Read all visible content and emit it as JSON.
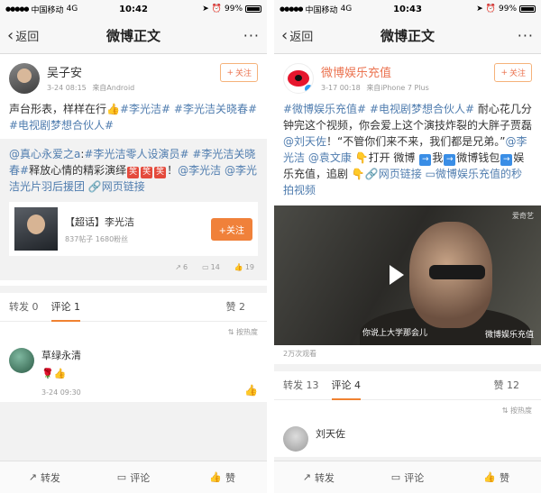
{
  "left": {
    "status": {
      "carrier": "中国移动",
      "network": "4G",
      "time": "10:42",
      "battery": "99%"
    },
    "nav": {
      "back": "返回",
      "title": "微博正文",
      "more": "···"
    },
    "post": {
      "user": "吴子安",
      "time": "3-24 08:15",
      "source": "来自Android",
      "follow": "关注",
      "text_plain": "声台形表，样样在行",
      "text_tags": "#李光洁# #李光洁关晓春# #电视剧梦想合伙人#",
      "repost_author": "@真心永爱之a",
      "repost_tags": "#李光洁零人设演员# #李光洁关晓春#",
      "repost_text": "释放心情的精彩演绎",
      "emoji_label": "笑",
      "repost_mentions": "@李光洁 @李光洁光片羽后援团",
      "repost_link": "网页链接",
      "topic": {
        "title": "【超话】李光洁",
        "sub": "837帖子 1680粉丝",
        "button": "+关注"
      },
      "stats": {
        "reposts": "6",
        "comments": "14",
        "likes": "19"
      }
    },
    "tabs": {
      "repost": "转发 0",
      "comment": "评论 1",
      "like": "赞 2"
    },
    "sort": "按热度",
    "comment": {
      "name": "草绿永清",
      "time": "3-24 09:30"
    },
    "bottom": {
      "repost": "转发",
      "comment": "评论",
      "like": "赞"
    }
  },
  "right": {
    "status": {
      "carrier": "中国移动",
      "network": "4G",
      "time": "10:43",
      "battery": "99%"
    },
    "nav": {
      "back": "返回",
      "title": "微博正文",
      "more": "···"
    },
    "post": {
      "user": "微博娱乐充值",
      "time": "3-17 00:18",
      "source": "来自iPhone 7 Plus",
      "follow": "关注",
      "tags": "#微博娱乐充值# #电视剧梦想合伙人#",
      "text1": "耐心花几分钟完这个视频，你会爱上这个演技炸裂的大胖子贾磊",
      "mention1": "@刘天佐",
      "text2": "！“不管你们来不来，我们都是兄弟。”",
      "mention2": "@李光洁 @袁文康",
      "text3": "打开 微博",
      "text4": "我",
      "wallet": "微博钱包",
      "text5": "娱乐充值，追剧",
      "link": "网页链接",
      "video_link": "微博娱乐充值的秒拍视频",
      "video": {
        "subtitle": "你说上大学那会儿",
        "watermark_top": "爱奇艺",
        "watermark_bottom": "微博娱乐充值"
      },
      "views": "2万次观看"
    },
    "tabs": {
      "repost": "转发 13",
      "comment": "评论 4",
      "like": "赞 12"
    },
    "sort": "按热度",
    "comment": {
      "name": "刘天佐"
    },
    "bottom": {
      "repost": "转发",
      "comment": "评论",
      "like": "赞"
    }
  }
}
